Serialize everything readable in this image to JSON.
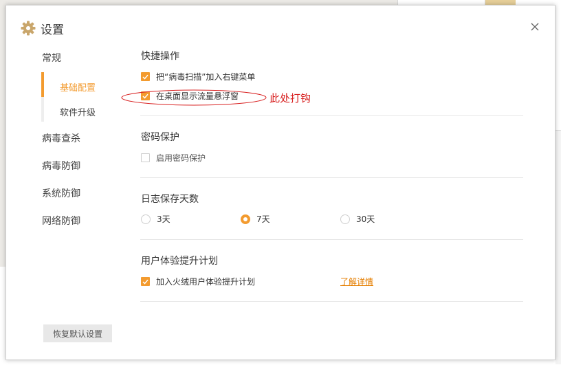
{
  "dialog": {
    "title": "设置",
    "icon": "gear-icon",
    "close_icon": "close-icon"
  },
  "sidebar": {
    "items": [
      {
        "label": "常规"
      },
      {
        "label": "病毒查杀"
      },
      {
        "label": "病毒防御"
      },
      {
        "label": "系统防御"
      },
      {
        "label": "网络防御"
      }
    ],
    "sub_items": [
      {
        "label": "基础配置",
        "active": true
      },
      {
        "label": "软件升级",
        "active": false
      }
    ]
  },
  "sections": {
    "shortcuts": {
      "title": "快捷操作",
      "options": [
        {
          "label": "把“病毒扫描”加入右键菜单",
          "checked": true
        },
        {
          "label": "在桌面显示流量悬浮窗",
          "checked": true
        }
      ]
    },
    "password": {
      "title": "密码保护",
      "options": [
        {
          "label": "启用密码保护",
          "checked": false
        }
      ]
    },
    "log_days": {
      "title": "日志保存天数",
      "options": [
        {
          "label": "3天",
          "selected": false
        },
        {
          "label": "7天",
          "selected": true
        },
        {
          "label": "30天",
          "selected": false
        }
      ]
    },
    "ux_plan": {
      "title": "用户体验提升计划",
      "option_label": "加入火绒用户体验提升计划",
      "checked": true,
      "link_label": "了解详情"
    }
  },
  "annotation": {
    "text": "此处打钩",
    "color": "#d82020"
  },
  "footer": {
    "reset_label": "恢复默认设置"
  },
  "colors": {
    "accent": "#f39b2f",
    "link": "#e57e00"
  }
}
